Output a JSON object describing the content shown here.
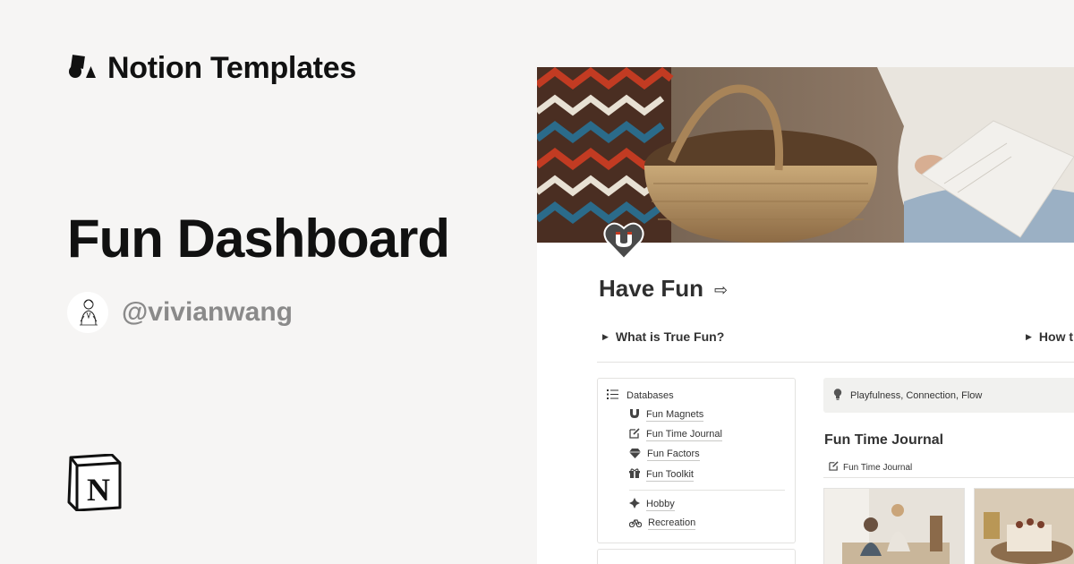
{
  "brand": {
    "name": "Notion Templates",
    "icon": "shapes-icon"
  },
  "template": {
    "title": "Fun Dashboard",
    "author_handle": "@vivianwang",
    "logo": "notion-logo"
  },
  "preview": {
    "page_icon": "heart-magnet-icon",
    "page_title": "Have Fun",
    "title_arrow": "⇨",
    "toggles": [
      {
        "label": "What is True Fun?"
      },
      {
        "label": "How t"
      }
    ],
    "databases": {
      "header": "Databases",
      "items": [
        {
          "label": "Fun Magnets",
          "icon": "magnet-icon"
        },
        {
          "label": "Fun Time Journal",
          "icon": "edit-icon"
        },
        {
          "label": "Fun Factors",
          "icon": "gem-icon"
        },
        {
          "label": "Fun Toolkit",
          "icon": "gift-icon"
        }
      ],
      "extra_items": [
        {
          "label": "Hobby",
          "icon": "compass-icon"
        },
        {
          "label": "Recreation",
          "icon": "bicycle-icon"
        }
      ]
    },
    "callout": {
      "text": "Playfulness, Connection, Flow",
      "icon": "lightbulb-icon"
    },
    "journal": {
      "title": "Fun Time Journal",
      "link_label": "Fun Time Journal",
      "link_icon": "edit-icon"
    }
  },
  "colors": {
    "background": "#f6f5f4",
    "handle": "#8a8a8a",
    "text": "#111111"
  }
}
